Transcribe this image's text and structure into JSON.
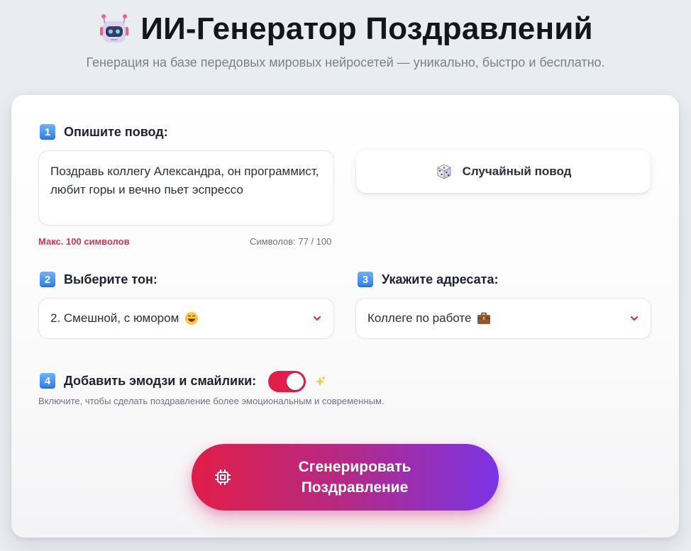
{
  "header": {
    "title": "ИИ-Генератор Поздравлений",
    "subtitle": "Генерация на базе передовых мировых нейросетей — уникально, быстро и бесплатно.",
    "logo_icon": "robot-icon"
  },
  "step1": {
    "number": "1",
    "label": "Опишите повод:",
    "textarea_value": "Поздравь коллегу Александра, он программист, любит горы и вечно пьет эспрессо",
    "limit_hint": "Макс. 100 символов",
    "counter": "Символов: 77 / 100",
    "random_button": {
      "label": "Случайный повод",
      "icon": "dice-icon"
    }
  },
  "step2": {
    "number": "2",
    "label": "Выберите тон:",
    "selected": "2. Смешной, с юмором",
    "selected_icon": "laughing-emoji-icon"
  },
  "step3": {
    "number": "3",
    "label": "Укажите адресата:",
    "selected": "Коллеге по работе",
    "selected_icon": "briefcase-icon"
  },
  "step4": {
    "number": "4",
    "label": "Добавить эмодзи и смайлики:",
    "toggle_on": true,
    "hint": "Включите, чтобы сделать поздравление более эмоциональным и современным.",
    "sparkle_icon": "sparkles-icon"
  },
  "generate_button": {
    "label_line1": "Сгенерировать",
    "label_line2": "Поздравление",
    "icon": "chip-icon"
  },
  "colors": {
    "accent_red": "#e11d48",
    "accent_purple": "#7a34e6",
    "badge_blue": "#2f7ce8",
    "hint_red": "#d0344e"
  }
}
